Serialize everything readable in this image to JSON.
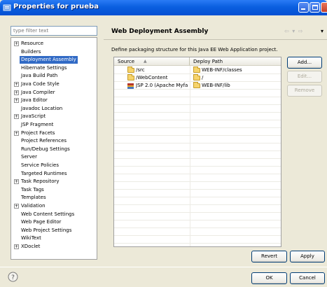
{
  "window": {
    "title": "Properties for prueba"
  },
  "filter": {
    "placeholder": "type filter text"
  },
  "tree": {
    "items": [
      {
        "label": "Resource",
        "expandable": true,
        "expander": "+"
      },
      {
        "label": "Builders",
        "expandable": false
      },
      {
        "label": "Deployment Assembly",
        "expandable": false,
        "selected": true
      },
      {
        "label": "Hibernate Settings",
        "expandable": false
      },
      {
        "label": "Java Build Path",
        "expandable": false
      },
      {
        "label": "Java Code Style",
        "expandable": true,
        "expander": "+"
      },
      {
        "label": "Java Compiler",
        "expandable": true,
        "expander": "+"
      },
      {
        "label": "Java Editor",
        "expandable": true,
        "expander": "+"
      },
      {
        "label": "Javadoc Location",
        "expandable": false
      },
      {
        "label": "JavaScript",
        "expandable": true,
        "expander": "+"
      },
      {
        "label": "JSP Fragment",
        "expandable": false
      },
      {
        "label": "Project Facets",
        "expandable": true,
        "expander": "+"
      },
      {
        "label": "Project References",
        "expandable": false
      },
      {
        "label": "Run/Debug Settings",
        "expandable": false
      },
      {
        "label": "Server",
        "expandable": false
      },
      {
        "label": "Service Policies",
        "expandable": false
      },
      {
        "label": "Targeted Runtimes",
        "expandable": false
      },
      {
        "label": "Task Repository",
        "expandable": true,
        "expander": "+"
      },
      {
        "label": "Task Tags",
        "expandable": false
      },
      {
        "label": "Templates",
        "expandable": false
      },
      {
        "label": "Validation",
        "expandable": true,
        "expander": "+"
      },
      {
        "label": "Web Content Settings",
        "expandable": false
      },
      {
        "label": "Web Page Editor",
        "expandable": false
      },
      {
        "label": "Web Project Settings",
        "expandable": false
      },
      {
        "label": "WikiText",
        "expandable": false
      },
      {
        "label": "XDoclet",
        "expandable": true,
        "expander": "+"
      }
    ]
  },
  "page": {
    "title": "Web Deployment Assembly",
    "description": "Define packaging structure for this Java EE Web Application project.",
    "nav_back": "⇦",
    "nav_forward": "⇨",
    "nav_sep": "▾",
    "menu": "▾"
  },
  "table": {
    "headers": [
      "Source",
      "Deploy Path"
    ],
    "sort_indicator": "▲",
    "rows": [
      {
        "source": "/src",
        "source_icon": "folder-icon",
        "deploy": "WEB-INF/classes",
        "deploy_icon": "folder-icon"
      },
      {
        "source": "/WebContent",
        "source_icon": "folder-icon",
        "deploy": "/",
        "deploy_icon": "folder-icon"
      },
      {
        "source": "JSP 2.0 (Apache Myfa",
        "source_icon": "library-jar-icon",
        "deploy": "WEB-INF/lib",
        "deploy_icon": "folder-icon"
      }
    ]
  },
  "buttons": {
    "add": "Add...",
    "edit": "Edit...",
    "remove": "Remove",
    "revert": "Revert",
    "apply": "Apply",
    "ok": "OK",
    "cancel": "Cancel"
  },
  "colors": {
    "titlebar": "#0a5fe0",
    "selection": "#316ac5",
    "dialog_bg": "#ece9d8"
  }
}
